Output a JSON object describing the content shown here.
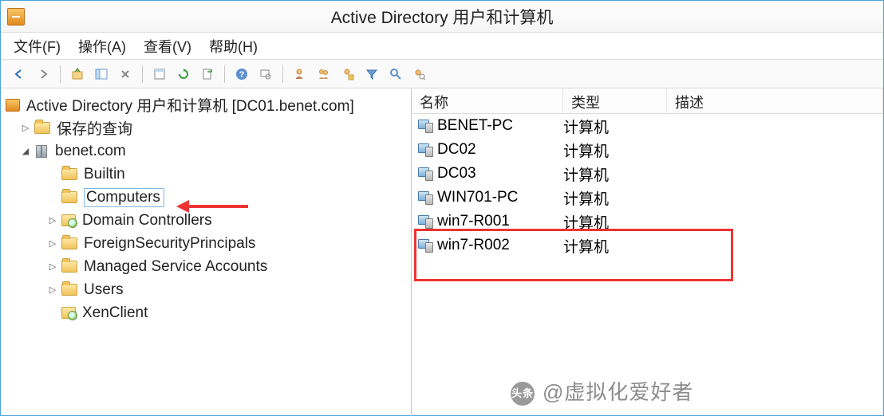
{
  "window": {
    "title": "Active Directory 用户和计算机"
  },
  "menu": {
    "file": "文件(F)",
    "action": "操作(A)",
    "view": "查看(V)",
    "help": "帮助(H)"
  },
  "tree": {
    "root": "Active Directory 用户和计算机 [DC01.benet.com]",
    "savedQueries": "保存的查询",
    "domain": "benet.com",
    "nodes": {
      "builtin": "Builtin",
      "computers": "Computers",
      "dc": "Domain Controllers",
      "fsp": "ForeignSecurityPrincipals",
      "msa": "Managed Service Accounts",
      "users": "Users",
      "xen": "XenClient"
    }
  },
  "list": {
    "headers": {
      "name": "名称",
      "type": "类型",
      "desc": "描述"
    },
    "typeComputer": "计算机",
    "rows": [
      {
        "name": "BENET-PC"
      },
      {
        "name": "DC02"
      },
      {
        "name": "DC03"
      },
      {
        "name": "WIN701-PC"
      },
      {
        "name": "win7-R001"
      },
      {
        "name": "win7-R002"
      }
    ]
  },
  "watermark": {
    "badge": "头条",
    "text": "@虚拟化爱好者"
  }
}
